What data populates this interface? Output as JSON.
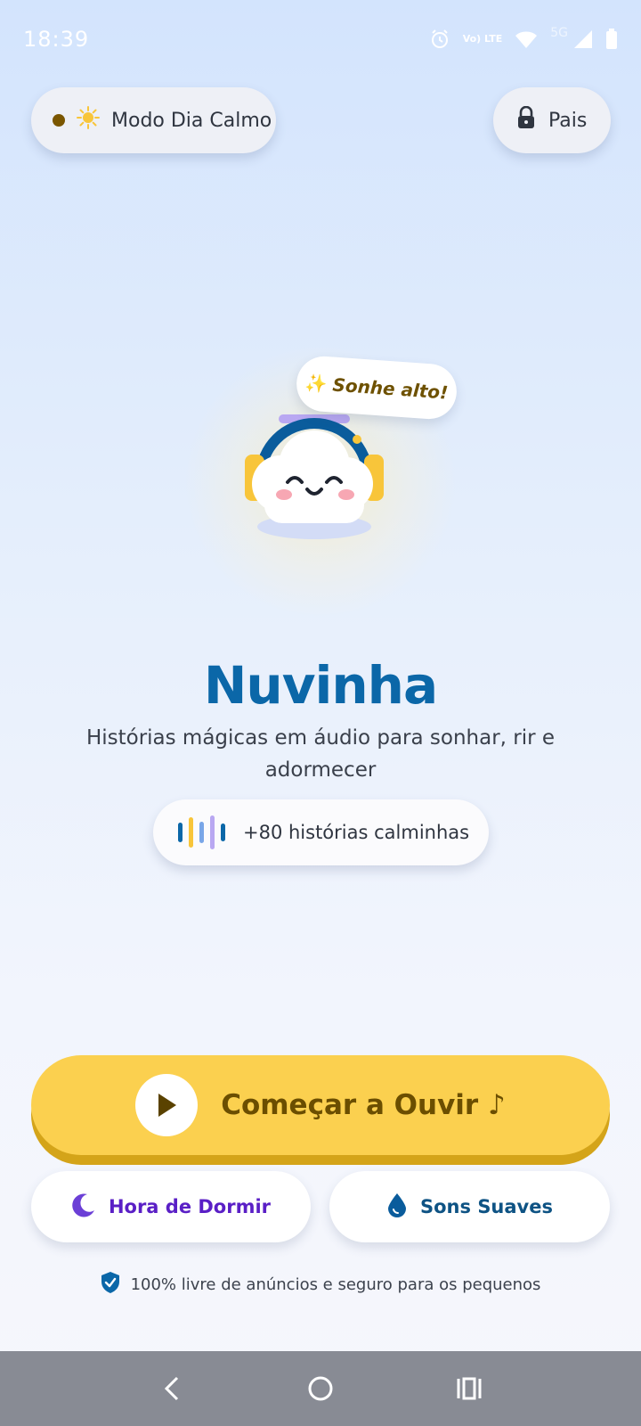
{
  "status_bar": {
    "time": "18:39",
    "network_label": "Vo) LTE",
    "gen_label": "5G"
  },
  "top_bar": {
    "mode_label": "Modo Dia Calmo",
    "mode_icon": "sun-icon",
    "parents_label": "Pais",
    "parents_icon": "lock-icon"
  },
  "hero": {
    "tag_label": "Sonhe alto!",
    "tag_icon": "sparkles-icon",
    "mascot": "cloud-with-headphones"
  },
  "app": {
    "title": "Nuvinha",
    "tagline": "Histórias mágicas em áudio para sonhar, rir e adormecer",
    "stories_count_label": "+80 histórias calminhas"
  },
  "actions": {
    "start_label": "Começar a Ouvir ♪",
    "bedtime_label": "Hora de Dormir",
    "sounds_label": "Sons Suaves"
  },
  "footer": {
    "safety_text": "100% livre de anúncios e seguro para os pequenos"
  },
  "colors": {
    "brand_blue": "#0b67a8",
    "cta_yellow": "#fbd04f",
    "cta_text": "#6b4e00",
    "bedtime_purple": "#5a1fc6",
    "sounds_blue": "#0e5384"
  }
}
